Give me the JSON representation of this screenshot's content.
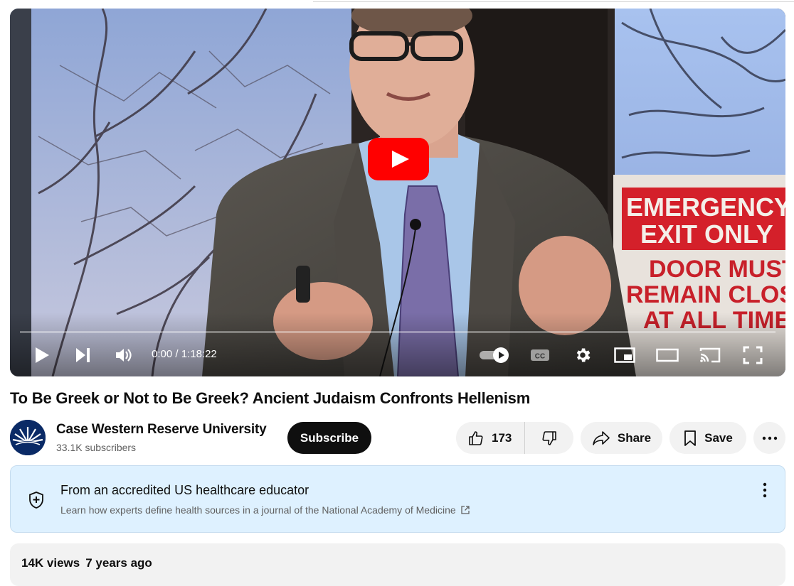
{
  "player": {
    "time_current": "0:00",
    "time_separator": " / ",
    "time_total": "1:18:22",
    "progress_fraction": 0,
    "sign": {
      "line1": "EMERGENCY",
      "line2": "EXIT ONLY",
      "line3": "DOOR MUST",
      "line4": "REMAIN CLOSED",
      "line5": "AT ALL TIMES"
    }
  },
  "video": {
    "title": "To Be Greek or Not to Be Greek? Ancient Judaism Confronts Hellenism"
  },
  "channel": {
    "name": "Case Western Reserve University",
    "subscribers": "33.1K subscribers",
    "subscribe_label": "Subscribe"
  },
  "actions": {
    "like_count": "173",
    "share_label": "Share",
    "save_label": "Save"
  },
  "info_panel": {
    "title": "From an accredited US healthcare educator",
    "subtitle": "Learn how experts define health sources in a journal of the National Academy of Medicine"
  },
  "description": {
    "views": "14K views",
    "age": "7 years ago"
  },
  "colors": {
    "accent_red": "#ff0000",
    "info_panel_bg": "#def1ff",
    "button_bg": "#f2f2f2",
    "subscribe_bg": "#0f0f0f"
  }
}
